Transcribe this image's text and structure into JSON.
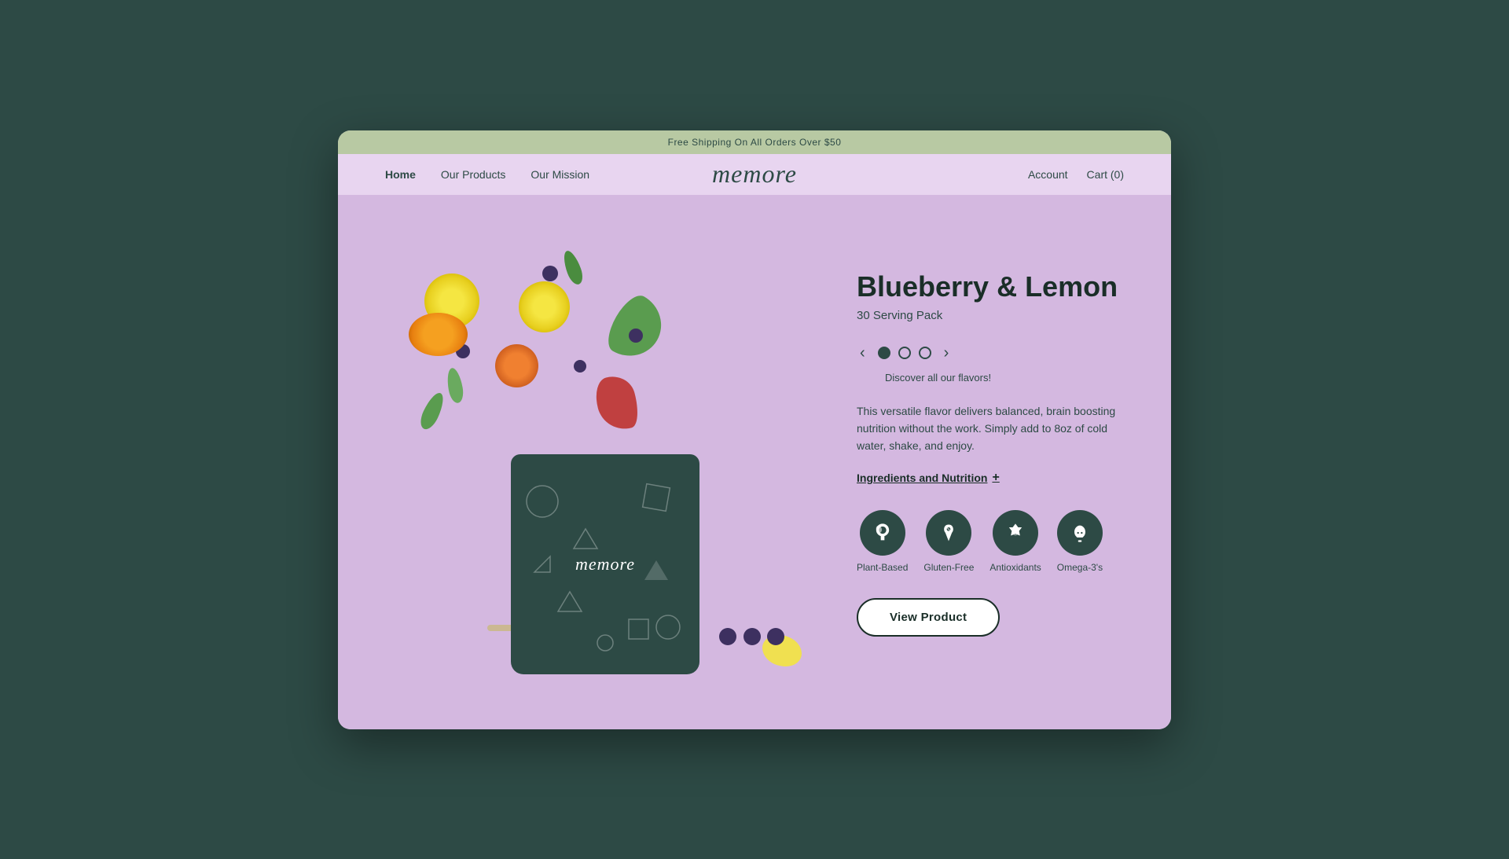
{
  "browser": {
    "background": "#2d4a45"
  },
  "banner": {
    "text": "Free Shipping On All Orders Over $50"
  },
  "nav": {
    "home": "Home",
    "products": "Our Products",
    "mission": "Our Mission",
    "logo": "memore",
    "account": "Account",
    "cart": "Cart  (0)"
  },
  "product": {
    "title": "Blueberry & Lemon",
    "subtitle": "30 Serving Pack",
    "discover_text": "Discover all our flavors!",
    "description": "This versatile flavor delivers balanced, brain boosting nutrition without the work. Simply add to 8oz of cold water, shake, and enjoy.",
    "ingredients_label": "Ingredients and Nutrition",
    "features": [
      {
        "id": "plant-based",
        "label": "Plant-Based",
        "icon": "leaf"
      },
      {
        "id": "gluten-free",
        "label": "Gluten-Free",
        "icon": "wheat"
      },
      {
        "id": "antioxidants",
        "label": "Antioxidants",
        "icon": "shield"
      },
      {
        "id": "omega3",
        "label": "Omega-3's",
        "icon": "fish"
      }
    ],
    "cta": "View Product",
    "dots": [
      {
        "filled": true
      },
      {
        "filled": false
      },
      {
        "filled": false
      }
    ]
  },
  "colors": {
    "dark_green": "#2d4a45",
    "light_purple": "#d4b8e0",
    "banner_green": "#b8c9a3"
  }
}
